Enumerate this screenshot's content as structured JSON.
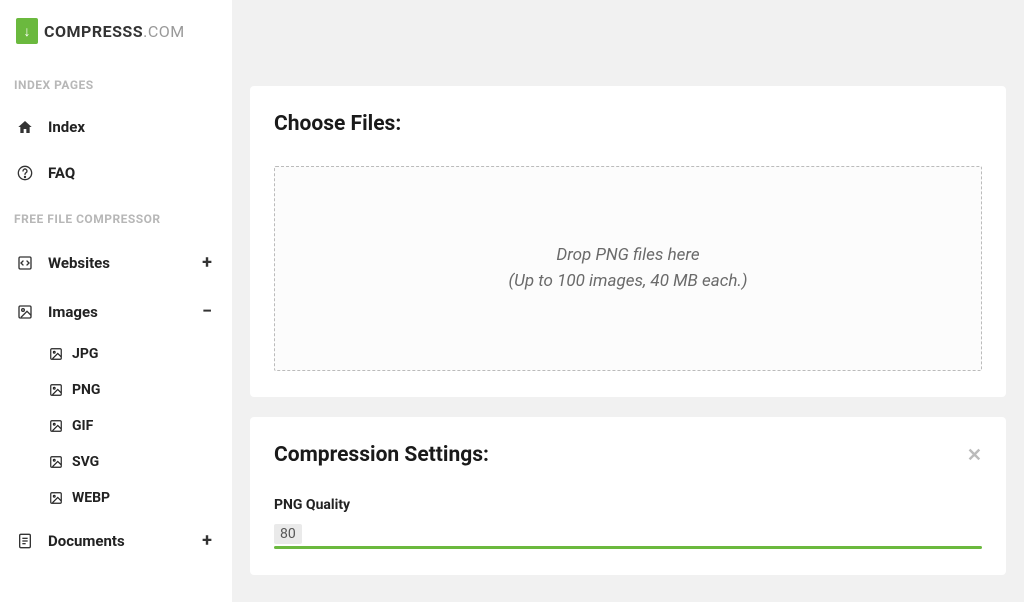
{
  "logo": {
    "bold": "COMPRESSS",
    "domain": ".COM"
  },
  "sections": {
    "index": "INDEX PAGES",
    "compressor": "FREE FILE COMPRESSOR"
  },
  "nav": {
    "index": "Index",
    "faq": "FAQ",
    "websites": "Websites",
    "images": "Images",
    "documents": "Documents"
  },
  "subnav": {
    "jpg": "JPG",
    "png": "PNG",
    "gif": "GIF",
    "svg": "SVG",
    "webp": "WEBP"
  },
  "choose_files": {
    "title": "Choose Files:",
    "drop_line1": "Drop PNG files here",
    "drop_line2": "(Up to 100 images, 40 MB each.)"
  },
  "settings": {
    "title": "Compression Settings:",
    "quality_label": "PNG Quality",
    "quality_value": "80"
  }
}
